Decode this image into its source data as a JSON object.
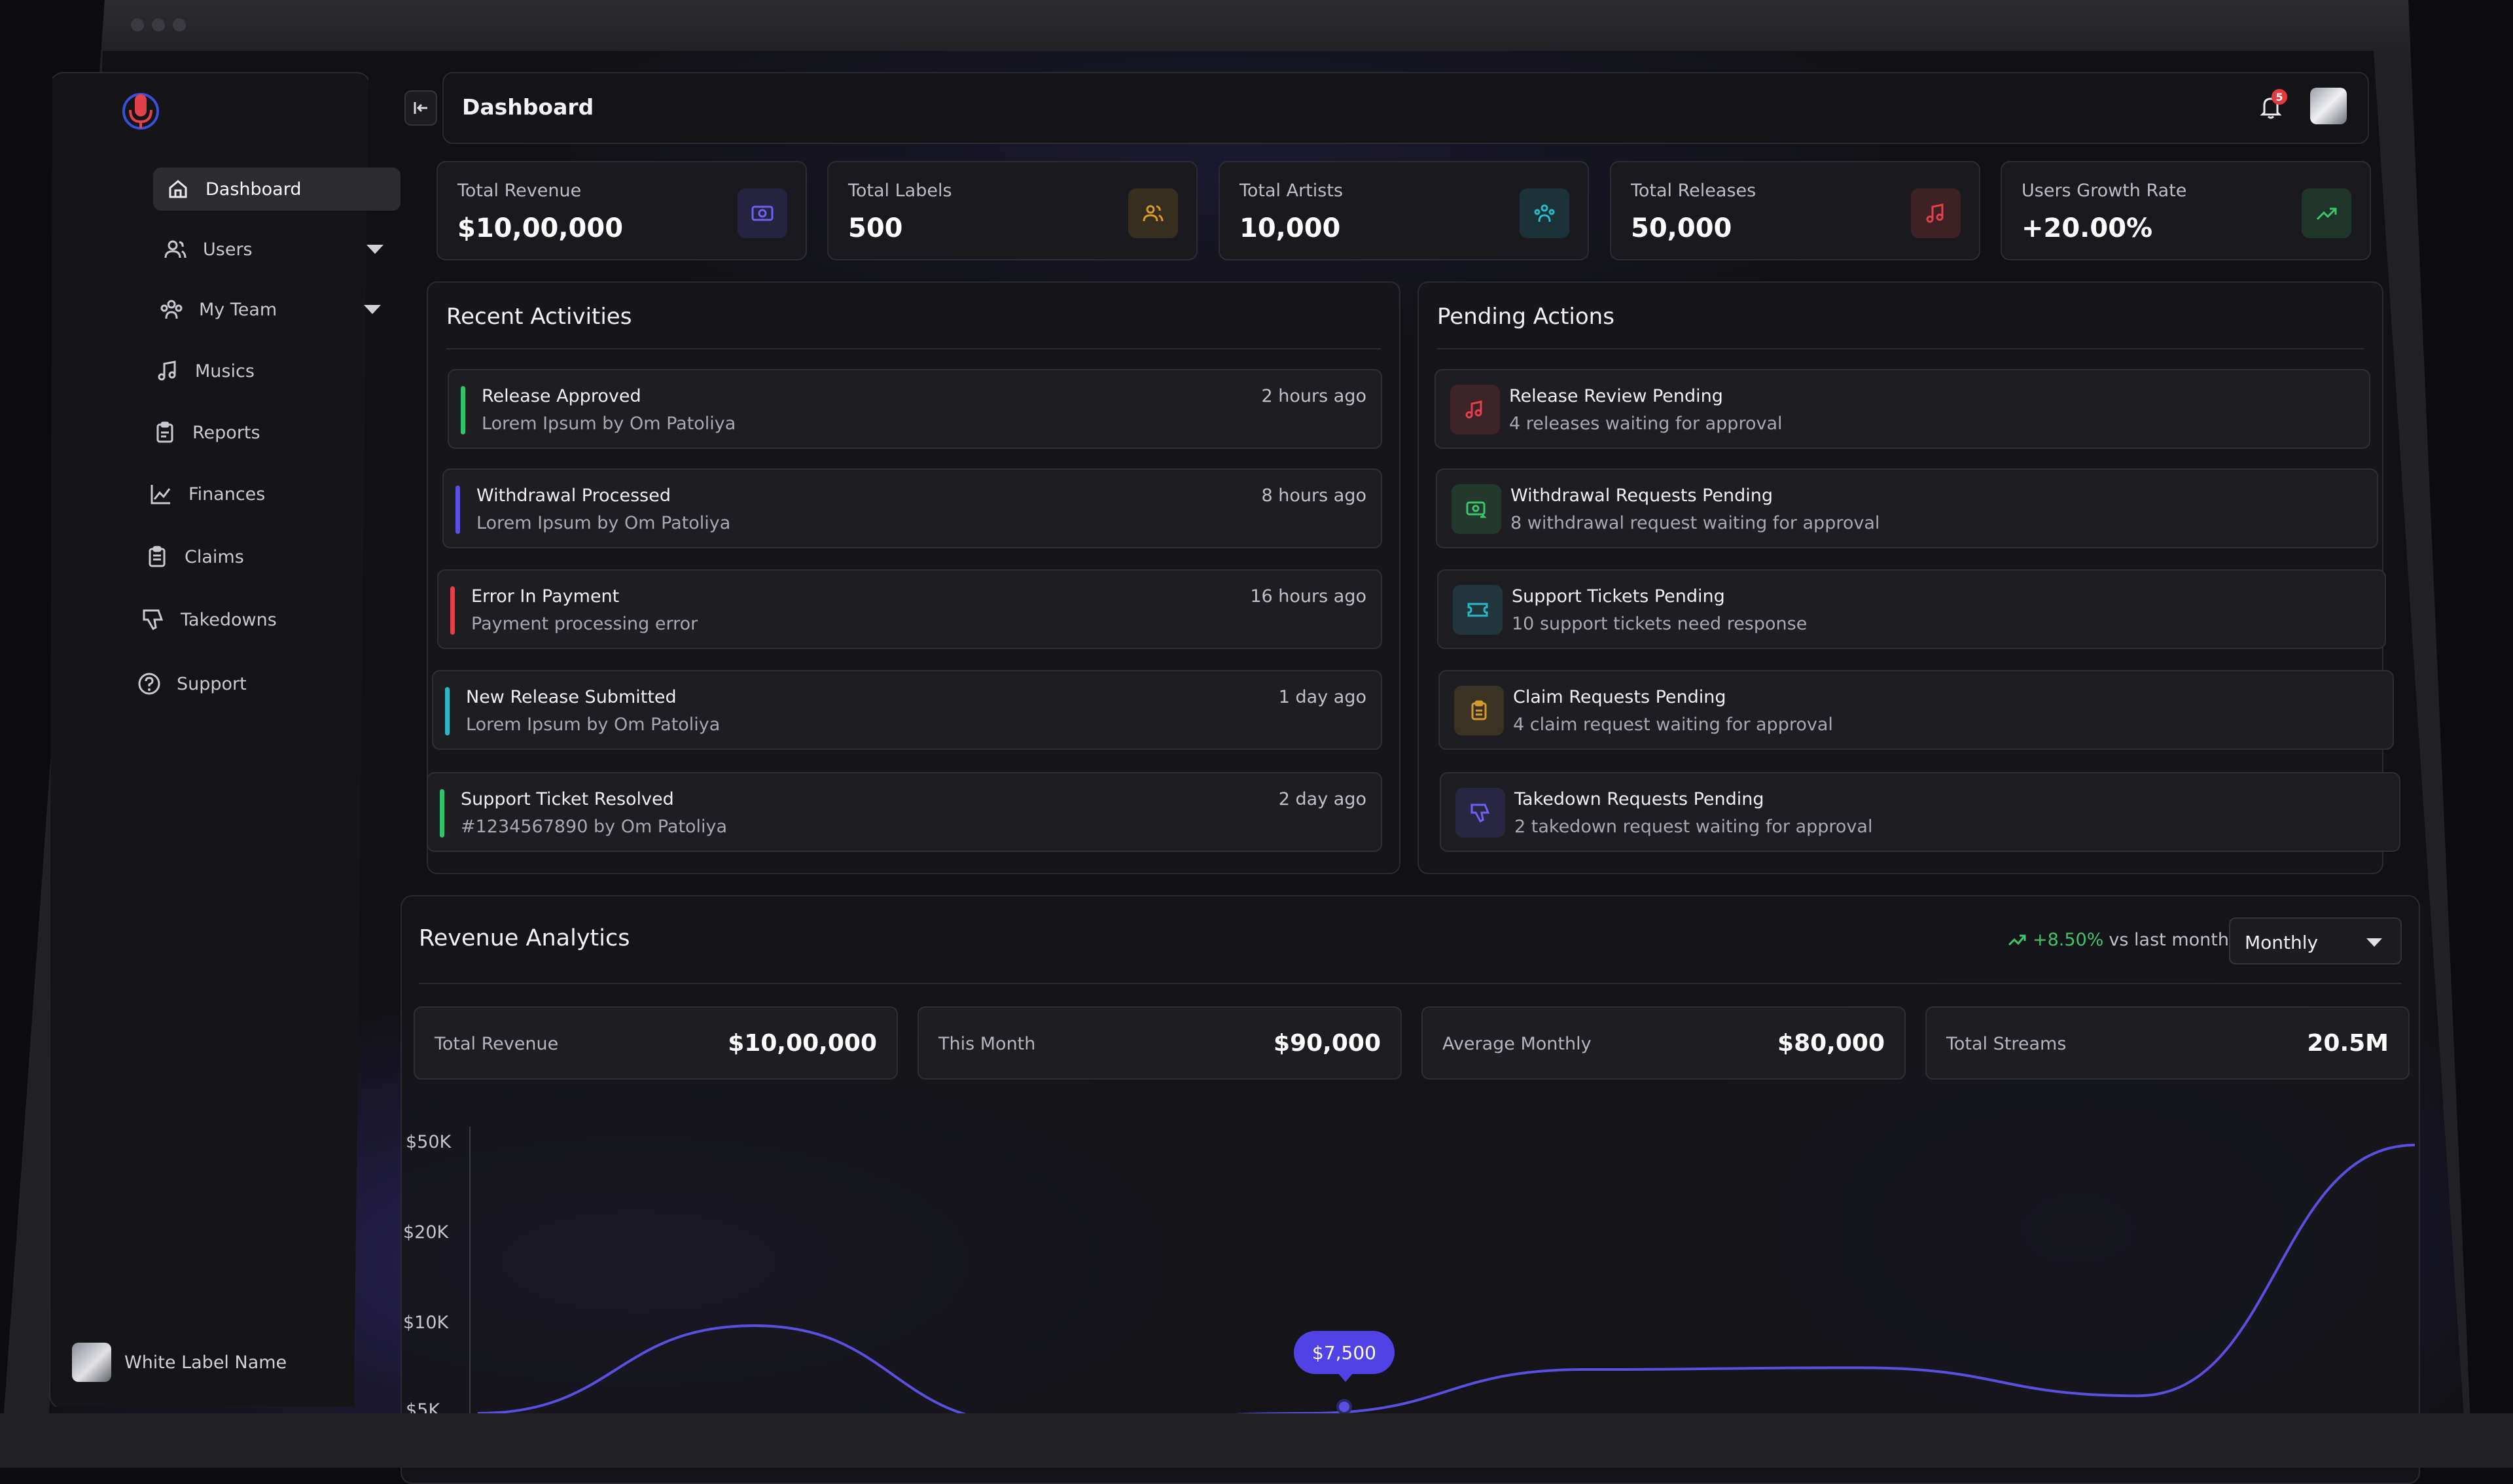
{
  "header": {
    "title": "Dashboard",
    "notification_count": "5"
  },
  "sidebar": {
    "items": [
      {
        "label": "Dashboard",
        "icon": "home-icon",
        "active": true
      },
      {
        "label": "Users",
        "icon": "users-icon",
        "has_submenu": true
      },
      {
        "label": "My Team",
        "icon": "team-icon",
        "has_submenu": true
      },
      {
        "label": "Musics",
        "icon": "music-icon"
      },
      {
        "label": "Reports",
        "icon": "clipboard-icon"
      },
      {
        "label": "Finances",
        "icon": "chart-icon"
      },
      {
        "label": "Claims",
        "icon": "clipboard-list-icon"
      },
      {
        "label": "Takedowns",
        "icon": "thumbs-down-icon"
      },
      {
        "label": "Support",
        "icon": "help-circle-icon"
      }
    ],
    "profile_name": "White Label Name"
  },
  "stats": [
    {
      "label": "Total Revenue",
      "value": "$10,00,000",
      "icon": "money-icon",
      "color": "#5a4fe0"
    },
    {
      "label": "Total Labels",
      "value": "500",
      "icon": "users-icon",
      "color": "#d69a2c"
    },
    {
      "label": "Total Artists",
      "value": "10,000",
      "icon": "team-icon",
      "color": "#2bb7c6"
    },
    {
      "label": "Total Releases",
      "value": "50,000",
      "icon": "music-icon",
      "color": "#e0414a"
    },
    {
      "label": "Users Growth Rate",
      "value": "+20.00%",
      "icon": "trending-up-icon",
      "color": "#3fc46b"
    }
  ],
  "recent_activities": {
    "title": "Recent Activities",
    "items": [
      {
        "title": "Release Approved",
        "subtitle": "Lorem Ipsum by Om Patoliya",
        "time": "2 hours ago",
        "color": "#32c26b"
      },
      {
        "title": "Withdrawal Processed",
        "subtitle": "Lorem Ipsum by Om Patoliya",
        "time": "8 hours ago",
        "color": "#5a4fe0"
      },
      {
        "title": "Error In Payment",
        "subtitle": "Payment processing error",
        "time": "16 hours ago",
        "color": "#e0414a"
      },
      {
        "title": "New Release Submitted",
        "subtitle": "Lorem Ipsum by Om Patoliya",
        "time": "1 day ago",
        "color": "#2bb7c6"
      },
      {
        "title": "Support Ticket Resolved",
        "subtitle": "#1234567890 by Om Patoliya",
        "time": "2 day ago",
        "color": "#32c26b"
      }
    ]
  },
  "pending_actions": {
    "title": "Pending Actions",
    "items": [
      {
        "title": "Release Review Pending",
        "subtitle": "4 releases waiting for approval",
        "icon": "music-icon",
        "color": "#e0414a"
      },
      {
        "title": "Withdrawal Requests Pending",
        "subtitle": "8 withdrawal request waiting for approval",
        "icon": "money-transfer-icon",
        "color": "#3fc46b"
      },
      {
        "title": "Support Tickets Pending",
        "subtitle": "10 support tickets need response",
        "icon": "ticket-icon",
        "color": "#2bb7c6"
      },
      {
        "title": "Claim Requests Pending",
        "subtitle": "4 claim request waiting for approval",
        "icon": "clipboard-icon",
        "color": "#d69a2c"
      },
      {
        "title": "Takedown Requests Pending",
        "subtitle": "2 takedown request waiting for approval",
        "icon": "thumbs-down-icon",
        "color": "#5a4fe0"
      }
    ]
  },
  "revenue_analytics": {
    "title": "Revenue Analytics",
    "growth_value": "+8.50%",
    "growth_suffix": "vs last month",
    "period": "Monthly",
    "stats": [
      {
        "label": "Total Revenue",
        "value": "$10,00,000"
      },
      {
        "label": "This Month",
        "value": "$90,000"
      },
      {
        "label": "Average Monthly",
        "value": "$80,000"
      },
      {
        "label": "Total Streams",
        "value": "20.5M"
      }
    ],
    "tooltip": "$7,500"
  },
  "chart_data": {
    "type": "line",
    "y_tick_labels": [
      "$50K",
      "$20K",
      "$10K",
      "$5K"
    ],
    "series": [
      {
        "values": [
          5000,
          10000,
          4000,
          5000,
          7500,
          7600,
          6000,
          50000
        ]
      }
    ],
    "highlight": {
      "value": 7500,
      "label": "$7,500"
    },
    "color": "#5a4fe0"
  }
}
